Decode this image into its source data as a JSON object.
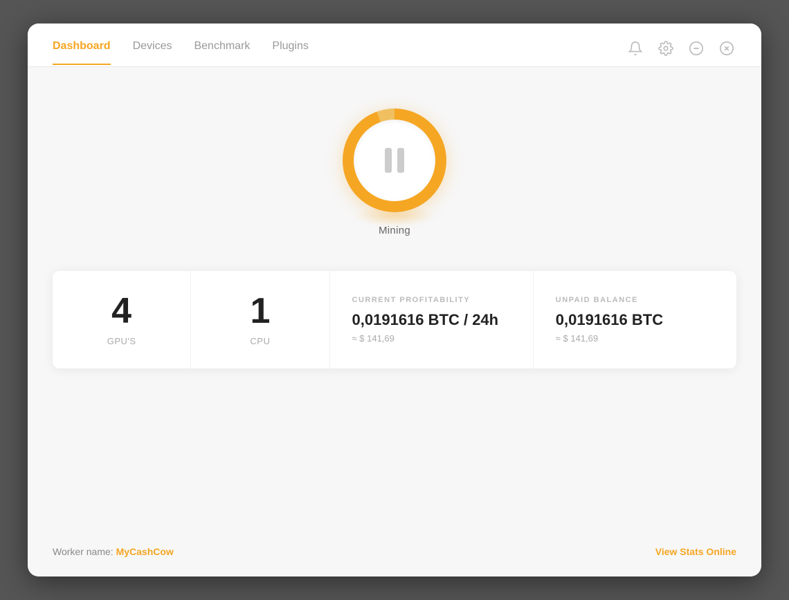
{
  "nav": {
    "tabs": [
      {
        "id": "dashboard",
        "label": "Dashboard",
        "active": true
      },
      {
        "id": "devices",
        "label": "Devices",
        "active": false
      },
      {
        "id": "benchmark",
        "label": "Benchmark",
        "active": false
      },
      {
        "id": "plugins",
        "label": "Plugins",
        "active": false
      }
    ]
  },
  "header_icons": {
    "bell": "🔔",
    "settings": "⚙",
    "minimize": "⊖",
    "close": "⊗"
  },
  "mining": {
    "status_label": "Mining"
  },
  "stats": {
    "gpu_count": "4",
    "gpu_label": "GPU'S",
    "cpu_count": "1",
    "cpu_label": "CPU",
    "profitability": {
      "title": "CURRENT PROFITABILITY",
      "value": "0,0191616 BTC / 24h",
      "sub": "≈ $ 141,69"
    },
    "balance": {
      "title": "UNPAID BALANCE",
      "value": "0,0191616 BTC",
      "sub": "≈ $ 141,69"
    }
  },
  "footer": {
    "worker_label": "Worker name:",
    "worker_name": "MyCashCow",
    "view_stats": "View Stats Online"
  }
}
